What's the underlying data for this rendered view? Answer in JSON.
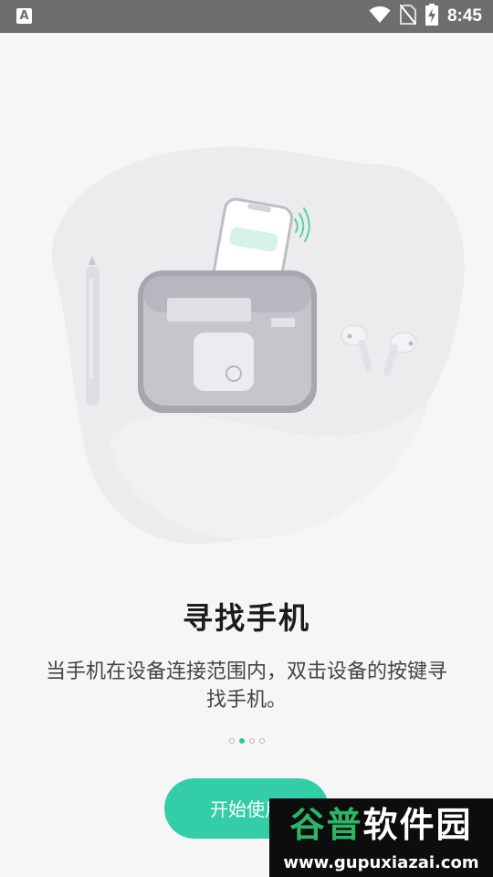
{
  "status_bar": {
    "app_icon_letter": "A",
    "time": "8:45"
  },
  "onboarding": {
    "title": "寻找手机",
    "description": "当手机在设备连接范围内，双击设备的按键寻找手机。",
    "page_count": 4,
    "active_page": 2,
    "start_button_label": "开始使用"
  },
  "watermark": {
    "line1_part1": "谷普",
    "line1_part2": "软件园",
    "line2": "www.gupuxiazai.com"
  },
  "colors": {
    "accent": "#33cda8",
    "status_bar": "#6e6e6e",
    "background": "#f6f6f7"
  }
}
